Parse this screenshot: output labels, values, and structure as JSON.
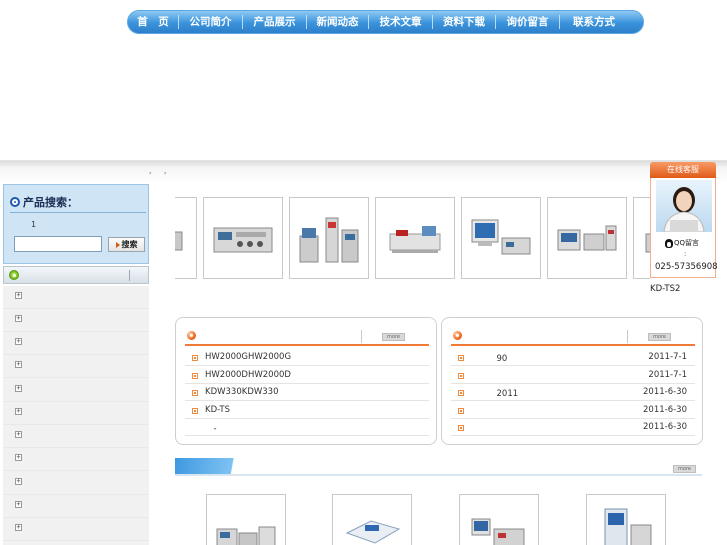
{
  "nav": {
    "items": [
      {
        "label": "首　页"
      },
      {
        "label": "公司简介"
      },
      {
        "label": "产品展示"
      },
      {
        "label": "新闻动态"
      },
      {
        "label": "技术文章"
      },
      {
        "label": "资料下载"
      },
      {
        "label": "询价留言"
      },
      {
        "label": "联系方式"
      }
    ]
  },
  "strip": {
    "mark1": "'",
    "mark2": "'"
  },
  "sidebar": {
    "search_title": "产品搜索：",
    "search_count": "1",
    "search_value": "",
    "search_button": "搜索",
    "categories": [
      "",
      "",
      "",
      "",
      "",
      "",
      "",
      "",
      "",
      "",
      ""
    ]
  },
  "slider": {
    "products": [
      {
        "icon": "instrument-icon"
      },
      {
        "icon": "analyzer-icon"
      },
      {
        "icon": "furnace-icon"
      },
      {
        "icon": "spectrometer-icon"
      },
      {
        "icon": "computer-analyzer-icon"
      },
      {
        "icon": "carbon-sulfur-icon"
      },
      {
        "icon": "instrument-icon"
      }
    ]
  },
  "floater": {
    "title": "在线客服",
    "qq_label": "QQ留言",
    "dot": ":",
    "phone": "025-57356908",
    "model": "KD-TS2"
  },
  "panel_left": {
    "more": "more",
    "rows": [
      {
        "title": "HW2000GHW2000G"
      },
      {
        "title": "HW2000DHW2000D"
      },
      {
        "title": "KDW330KDW330"
      },
      {
        "title": "KD-TS"
      },
      {
        "title": "　-"
      }
    ]
  },
  "panel_right": {
    "more": "more",
    "rows": [
      {
        "title": "　　　90",
        "date": "2011-7-1"
      },
      {
        "title": "",
        "date": "2011-7-1"
      },
      {
        "title": "　　　2011",
        "date": "2011-6-30"
      },
      {
        "title": "",
        "date": "2011-6-30"
      },
      {
        "title": "",
        "date": "2011-6-30"
      }
    ]
  },
  "featured": {
    "more": "more"
  },
  "colors": {
    "nav_blue": "#3a93dc",
    "accent_orange": "#f07b38",
    "sidebar_blue": "#cfe5f6"
  }
}
